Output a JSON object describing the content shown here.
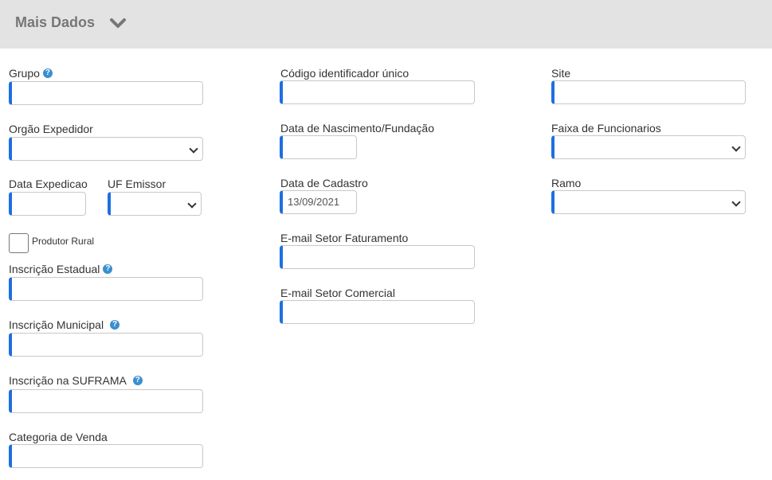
{
  "header": {
    "title": "Mais Dados",
    "toggle_icon": "chevron-down-icon"
  },
  "col1": {
    "grupo_label": "Grupo",
    "orgao_label": "Orgão Expedidor",
    "data_exp_label": "Data Expedicao",
    "uf_label": "UF Emissor",
    "produtor_label": "Produtor Rural",
    "insc_estadual_label": "Inscrição Estadual",
    "insc_municipal_label": "Inscrição Municipal",
    "suframa_label": "Inscrição na SUFRAMA",
    "categoria_label": "Categoria de Venda"
  },
  "col2": {
    "codigo_label": "Código identificador único",
    "nascimento_label": "Data de Nascimento/Fundação",
    "cadastro_label": "Data de Cadastro",
    "cadastro_value": "13/09/2021",
    "email_fat_label": "E-mail Setor Faturamento",
    "email_com_label": "E-mail Setor Comercial"
  },
  "col3": {
    "site_label": "Site",
    "faixa_label": "Faixa de Funcionarios",
    "ramo_label": "Ramo"
  },
  "help_icon": "?",
  "colors": {
    "accent": "#1e6fe0",
    "header_bg": "#e3e3e3",
    "help": "#3a8fd0"
  }
}
